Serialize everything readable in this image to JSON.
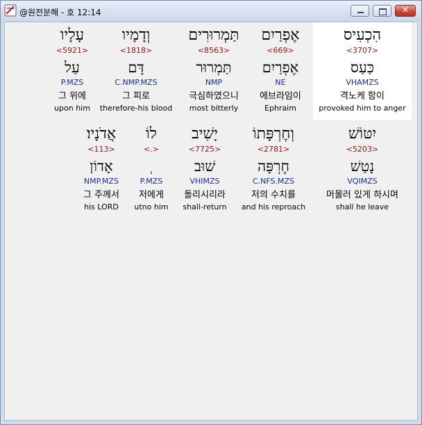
{
  "window": {
    "title": "@원전분해 - 호 12:14",
    "close_label": "✕"
  },
  "row1": [
    {
      "hebrew": "הִכְעִיס",
      "strong": "<3707>",
      "lemma": "כַּעַס",
      "morph": "VHAMZS",
      "korean": "격노케 함이",
      "english": "provoked him to anger"
    },
    {
      "hebrew": "אֶפְרַיִם",
      "strong": "<669>",
      "lemma": "אֶפְרַיִם",
      "morph": "NE",
      "korean": "에브라임이",
      "english": "Ephraim"
    },
    {
      "hebrew": "תַּמְרוּרִים",
      "strong": "<8563>",
      "lemma": "תַּמְרוּר",
      "morph": "NMP",
      "korean": "극심하였으니",
      "english": "most bitterly"
    },
    {
      "hebrew": "וְדָמָיו",
      "strong": "<1818>",
      "lemma": "דָּם",
      "morph": "C.NMP.MZS",
      "korean": "그 피로",
      "english": "therefore-his blood"
    },
    {
      "hebrew": "עָלָיו",
      "strong": "<5921>",
      "lemma": "עַל",
      "morph": "P.MZS",
      "korean": "그 위에",
      "english": "upon him"
    }
  ],
  "row2": [
    {
      "hebrew": "יִטּוֹשׁ",
      "strong": "<5203>",
      "lemma": "נָטַשׁ",
      "morph": "VQIMZS",
      "korean": "머물러 있게 하시며",
      "english": "shall he leave"
    },
    {
      "hebrew": "וְחֶרְפָּתוֹ",
      "strong": "<2781>",
      "lemma": "חֶרְפָּה",
      "morph": "C.NFS.MZS",
      "korean": "저의 수치를",
      "english": "and his reproach"
    },
    {
      "hebrew": "יָשִׁיב",
      "strong": "<7725>",
      "lemma": "שׁוּב",
      "morph": "VHIMZS",
      "korean": "돌리시리라",
      "english": "shall-return"
    },
    {
      "hebrew": "לוֹ",
      "strong": "<.>",
      "lemma": "ְ",
      "morph": "P.MZS",
      "korean": "저에게",
      "english": "utno him"
    },
    {
      "hebrew": "אֲדֹנָיו׃",
      "strong": "<113>",
      "lemma": "אָדוֹן",
      "morph": "NMP.MZS",
      "korean": "그 주께서",
      "english": "his LORD"
    }
  ]
}
